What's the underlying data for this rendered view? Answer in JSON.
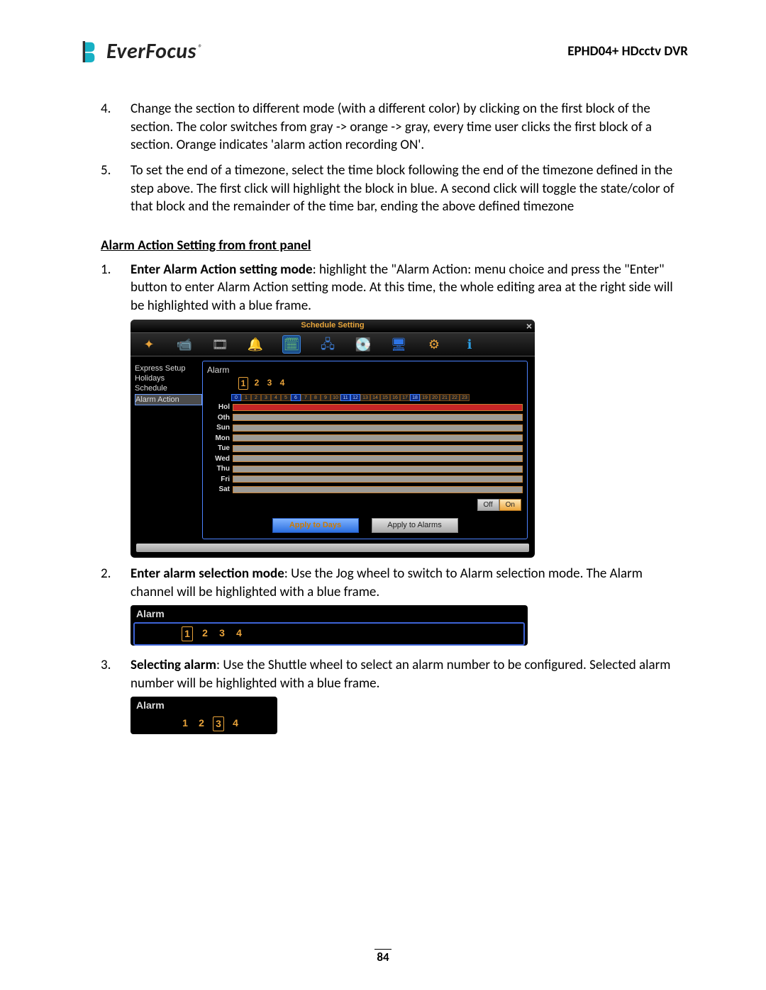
{
  "header": {
    "brand": "EverFocus",
    "model": "EPHD04+  HDcctv DVR"
  },
  "top_list": [
    {
      "num": "4.",
      "text": "Change the section to different mode (with a different color) by clicking on the first block of the section. The color switches from gray -> orange -> gray, every time user clicks the first block of a section. Orange indicates 'alarm action recording ON'."
    },
    {
      "num": "5.",
      "text": "To set the end of a timezone, select the time block following the end of the timezone defined in the step above. The first click will highlight the block in blue. A second click will toggle the state/color of that block and the remainder of the time bar, ending the above defined timezone"
    }
  ],
  "section_heading": "Alarm Action Setting from front panel",
  "step1": {
    "num": "1.",
    "bold": "Enter Alarm Action setting mode",
    "rest": ": highlight the \"Alarm Action: menu choice and press the \"Enter\" button to enter Alarm Action setting mode. At this time, the whole editing area at the right side will be highlighted with a blue frame."
  },
  "panel": {
    "title": "Schedule Setting",
    "sidebar": [
      "Express Setup",
      "Holidays",
      "Schedule",
      "Alarm Action"
    ],
    "sidebar_selected": 3,
    "alarm_label": "Alarm",
    "channels": [
      "1",
      "2",
      "3",
      "4"
    ],
    "channel_boxed": 0,
    "hours": [
      "0",
      "1",
      "2",
      "3",
      "4",
      "5",
      "6",
      "7",
      "8",
      "9",
      "10",
      "11",
      "12",
      "13",
      "14",
      "15",
      "16",
      "17",
      "18",
      "19",
      "20",
      "21",
      "22",
      "23"
    ],
    "blue_hours": [
      0,
      6,
      11,
      12,
      18
    ],
    "days": [
      "Hol",
      "Oth",
      "Sun",
      "Mon",
      "Tue",
      "Wed",
      "Thu",
      "Fri",
      "Sat"
    ],
    "off_label": "Off",
    "on_label": "On",
    "apply_days": "Apply to Days",
    "apply_alarms": "Apply to Alarms"
  },
  "step2": {
    "num": "2.",
    "bold": "Enter alarm selection mode",
    "rest": ": Use the Jog wheel to switch to Alarm selection mode. The Alarm channel will be highlighted with a blue frame."
  },
  "strip1": {
    "label": "Alarm",
    "nums": [
      "1",
      "2",
      "3",
      "4"
    ],
    "boxed": 0
  },
  "step3": {
    "num": "3.",
    "bold": "Selecting alarm",
    "rest": ": Use the Shuttle wheel to select an alarm number to be configured. Selected alarm number will be highlighted with a blue frame."
  },
  "strip2": {
    "label": "Alarm",
    "nums": [
      "1",
      "2",
      "3",
      "4"
    ],
    "boxed": 2
  },
  "page_number": "84"
}
